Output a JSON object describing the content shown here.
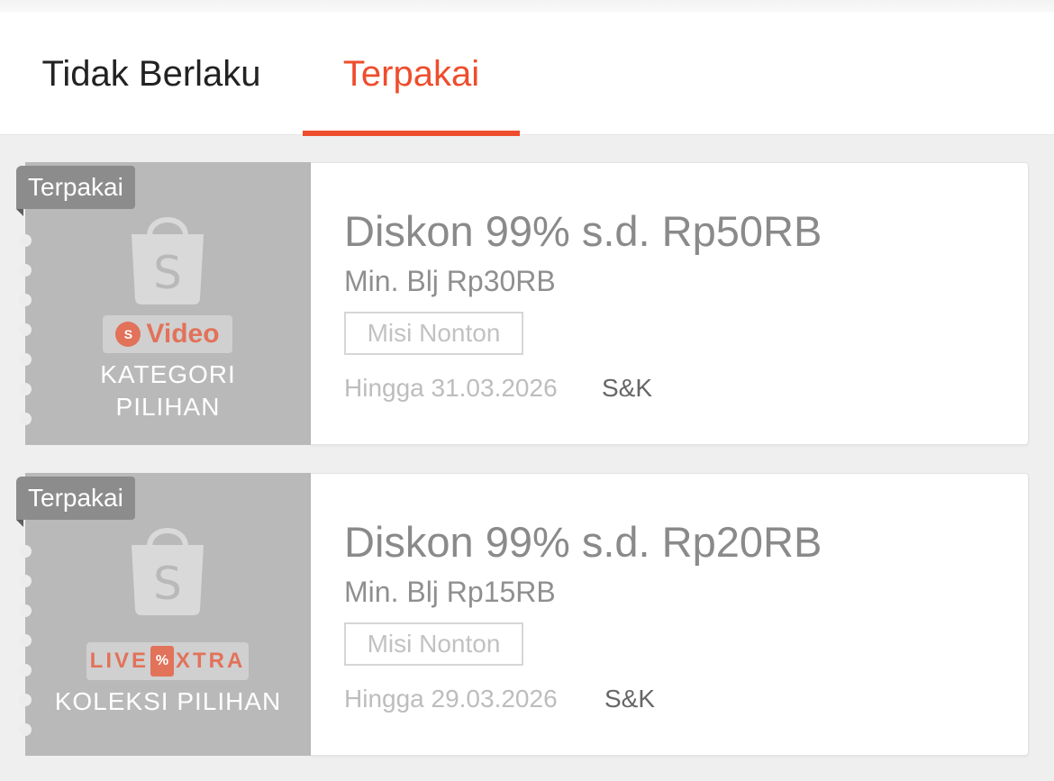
{
  "tabs": [
    {
      "label": "Tidak Berlaku",
      "active": false
    },
    {
      "label": "Terpakai",
      "active": true
    }
  ],
  "colors": {
    "accent": "#ee4d2d",
    "voucher_left_bg": "#b9b9b9",
    "badge_bg": "#8c8c8c",
    "chip_text": "#e2725a"
  },
  "vouchers": [
    {
      "status_badge": "Terpakai",
      "icon": "shopee-bag-icon",
      "chip_icon": "play-icon",
      "chip_label": "Video",
      "category_line1": "KATEGORI",
      "category_line2": "PILIHAN",
      "title": "Diskon 99% s.d. Rp50RB",
      "min_spend": "Min. Blj Rp30RB",
      "mission_tag": "Misi Nonton",
      "expiry": "Hingga 31.03.2026",
      "terms_link": "S&K"
    },
    {
      "status_badge": "Terpakai",
      "icon": "shopee-bag-icon",
      "chip_label_left": "LIVE",
      "chip_label_mid": "%",
      "chip_label_right": "XTRA",
      "category_line1": "KOLEKSI PILIHAN",
      "title": "Diskon 99% s.d. Rp20RB",
      "min_spend": "Min. Blj Rp15RB",
      "mission_tag": "Misi Nonton",
      "expiry": "Hingga 29.03.2026",
      "terms_link": "S&K"
    }
  ]
}
